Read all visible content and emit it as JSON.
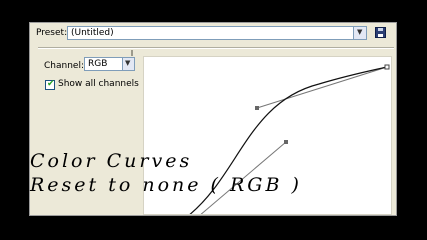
{
  "preset": {
    "label": "Preset:",
    "value": "(Untitled)"
  },
  "channel": {
    "label": "Channel:",
    "value": "RGB"
  },
  "options": {
    "show_all_channels_label": "Show all channels",
    "show_all_channels_checked": true
  },
  "overlay": {
    "line1": "Color Curves",
    "line2": "Reset to none ( RGB )"
  },
  "colors": {
    "panel": "#ece9d8",
    "field_border": "#7f9db9",
    "checkmark": "#21a121"
  },
  "icons": {
    "preset_dropdown": "chevron-down-icon",
    "save": "save-icon",
    "channel_dropdown": "chevron-down-icon"
  }
}
